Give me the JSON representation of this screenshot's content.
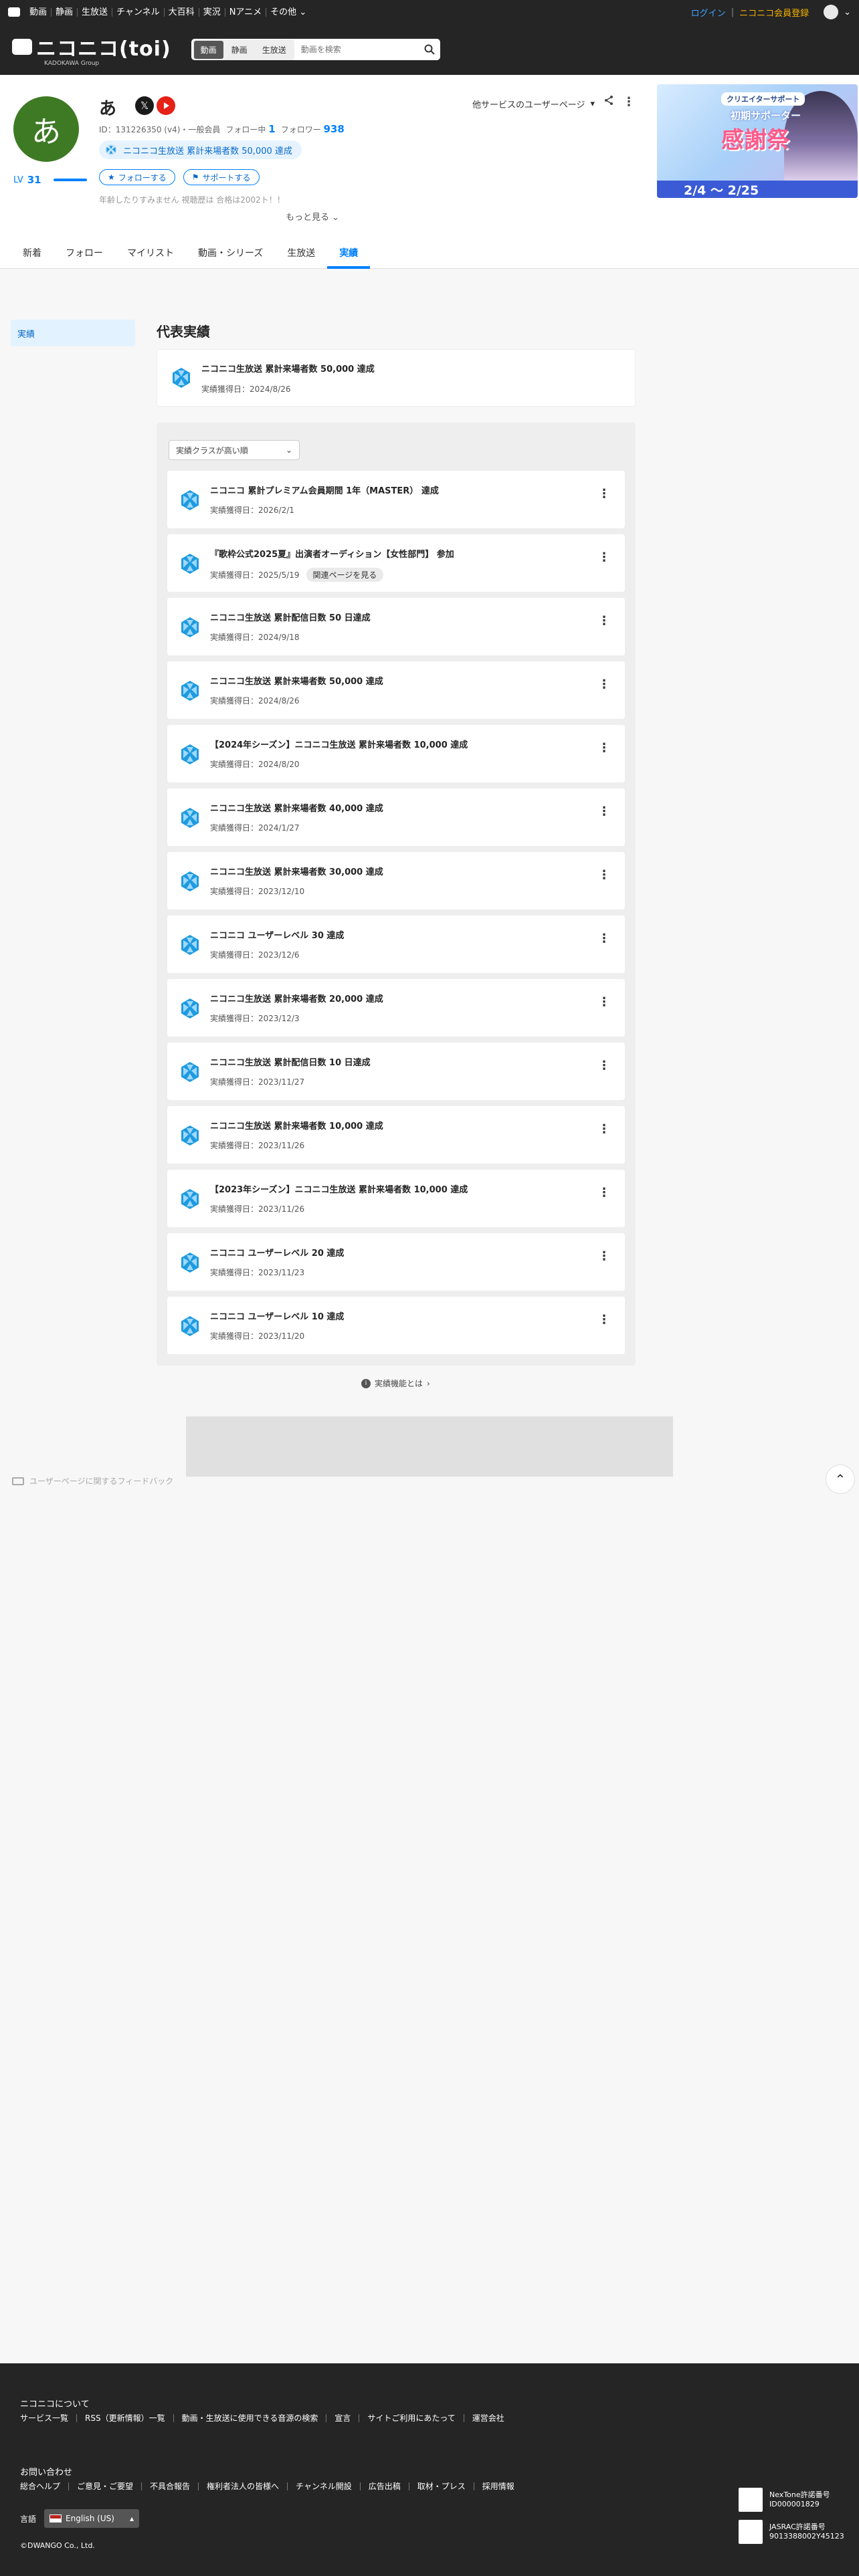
{
  "topnav": {
    "items": [
      "動画",
      "静画",
      "生放送",
      "チャンネル",
      "大百科",
      "実況",
      "Nアニメ",
      "その他"
    ],
    "login": "ログイン",
    "register": "ニコニコ会員登録"
  },
  "header": {
    "brand": "ニコニコ(toi)",
    "brand_sub": "KADOKAWA Group",
    "search_tabs": [
      "動画",
      "静画",
      "生放送"
    ],
    "search_placeholder": "動画を検索"
  },
  "profile": {
    "avatar_char": "あ",
    "name": "あ",
    "id_text": "ID：131226350 (v4)・一般会員",
    "following_label": "フォロー中",
    "following": "1",
    "followers_label": "フォロワー",
    "followers": "938",
    "badge": "ニコニコ生放送 累計来場者数 50,000 達成",
    "level_label": "LV",
    "level": "31",
    "follow_btn": "フォローする",
    "support_btn": "サポートする",
    "description": "年齢したりすみません 視聴歴は 合格は2002ト！！",
    "more": "もっと見る",
    "other_services": "他サービスのユーザーページ"
  },
  "banner": {
    "tag": "クリエイターサポート",
    "line1": "初期サポーター",
    "line2": "感謝祭",
    "dates": "2/4 〜 2/25"
  },
  "tabs": [
    "新着",
    "フォロー",
    "マイリスト",
    "動画・シリーズ",
    "生放送",
    "実績"
  ],
  "sidebar": {
    "item": "実績"
  },
  "representative": {
    "heading": "代表実績",
    "title": "ニコニコ生放送 累計来場者数 50,000 達成",
    "date": "実績獲得日：2024/8/26"
  },
  "sort": {
    "label": "実績クラスが高い順"
  },
  "achievements": [
    {
      "title": "ニコニコ 累計プレミアム会員期間 1年（MASTER） 達成",
      "date": "実績獲得日：2026/2/1"
    },
    {
      "title": "『歌枠公式2025夏』出演者オーディション【女性部門】 参加",
      "date": "実績獲得日：2025/5/19",
      "link": "関連ページを見る"
    },
    {
      "title": "ニコニコ生放送 累計配信日数 50 日達成",
      "date": "実績獲得日：2024/9/18"
    },
    {
      "title": "ニコニコ生放送 累計来場者数 50,000 達成",
      "date": "実績獲得日：2024/8/26"
    },
    {
      "title": "【2024年シーズン】ニコニコ生放送 累計来場者数 10,000 達成",
      "date": "実績獲得日：2024/8/20"
    },
    {
      "title": "ニコニコ生放送 累計来場者数 40,000 達成",
      "date": "実績獲得日：2024/1/27"
    },
    {
      "title": "ニコニコ生放送 累計来場者数 30,000 達成",
      "date": "実績獲得日：2023/12/10"
    },
    {
      "title": "ニコニコ ユーザーレベル 30 達成",
      "date": "実績獲得日：2023/12/6"
    },
    {
      "title": "ニコニコ生放送 累計来場者数 20,000 達成",
      "date": "実績獲得日：2023/12/3"
    },
    {
      "title": "ニコニコ生放送 累計配信日数 10 日達成",
      "date": "実績獲得日：2023/11/27"
    },
    {
      "title": "ニコニコ生放送 累計来場者数 10,000 達成",
      "date": "実績獲得日：2023/11/26"
    },
    {
      "title": "【2023年シーズン】ニコニコ生放送 累計来場者数 10,000 達成",
      "date": "実績獲得日：2023/11/26"
    },
    {
      "title": "ニコニコ ユーザーレベル 20 達成",
      "date": "実績獲得日：2023/11/23"
    },
    {
      "title": "ニコニコ ユーザーレベル 10 達成",
      "date": "実績獲得日：2023/11/20"
    }
  ],
  "help_link": "実績機能とは",
  "feedback": "ユーザーページに関するフィードバック",
  "footer": {
    "about": "ニコニコについて",
    "links1": [
      "サービス一覧",
      "RSS（更新情報）一覧",
      "動画・生放送に使用できる音源の検索",
      "宣言",
      "サイトご利用にあたって",
      "運営会社"
    ],
    "contact": "お問い合わせ",
    "links2": [
      "総合ヘルプ",
      "ご意見・ご要望",
      "不具合報告",
      "権利者法人の皆様へ",
      "チャンネル開設",
      "広告出稿",
      "取材・プレス",
      "採用情報"
    ],
    "lang_label": "言語",
    "lang_value": "English (US)",
    "copyright": "©DWANGO Co., Ltd.",
    "license1": [
      "NexTone許諾番号",
      "ID000001829"
    ],
    "license2": [
      "JASRAC許諾番号",
      "9013388002Y45123"
    ]
  },
  "colors": {
    "accent": "#0080ff",
    "dark": "#252525",
    "badge_bg": "#e6f3ff",
    "achievement_icon": "#1e9be0"
  }
}
